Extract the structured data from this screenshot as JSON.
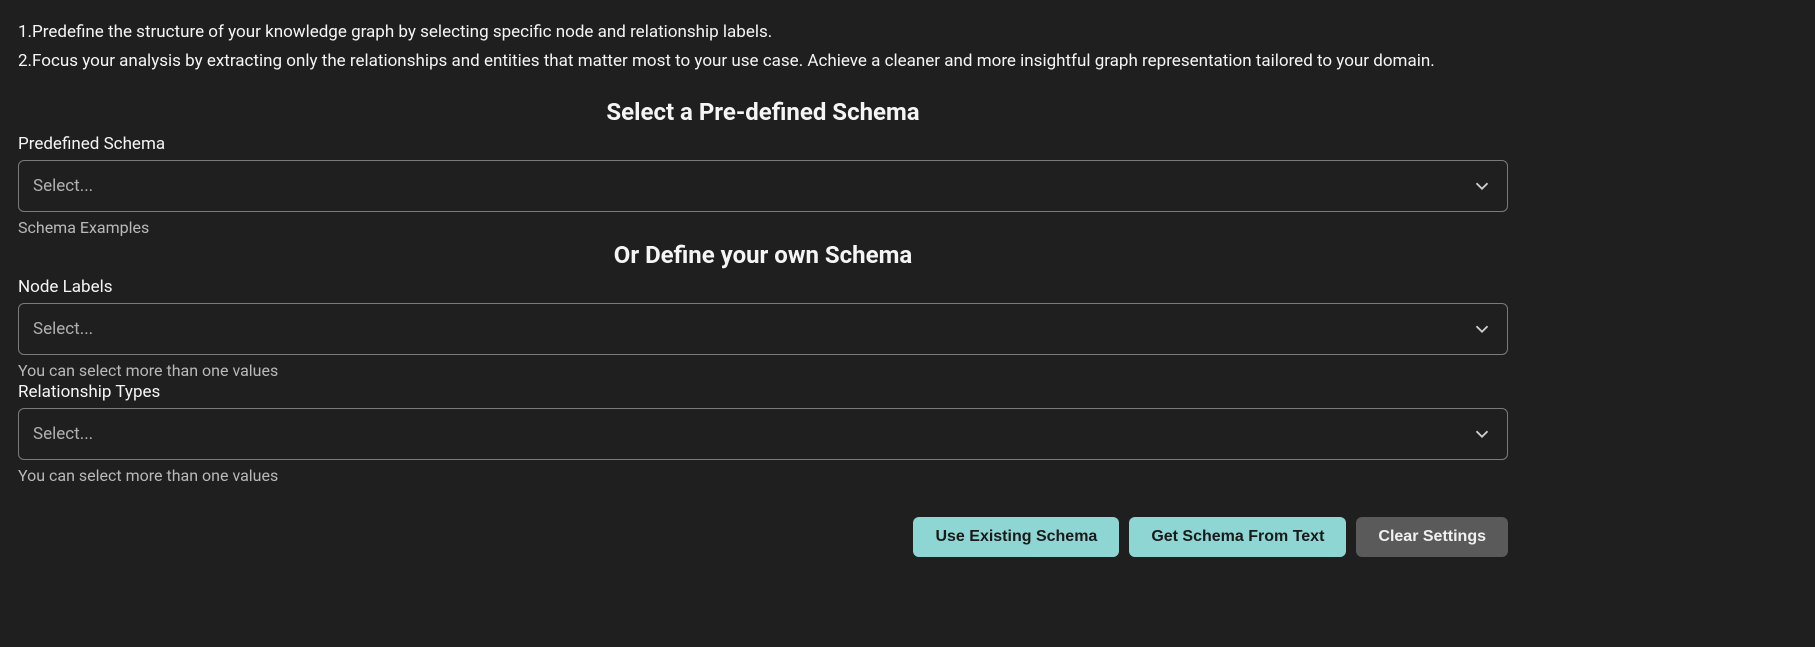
{
  "instructions": {
    "line1": "1.Predefine the structure of your knowledge graph by selecting specific node and relationship labels.",
    "line2": "2.Focus your analysis by extracting only the relationships and entities that matter most to your use case. Achieve a cleaner and more insightful graph representation tailored to your domain."
  },
  "sections": {
    "predefined": {
      "heading": "Select a Pre-defined Schema",
      "label": "Predefined Schema",
      "placeholder": "Select...",
      "helper": "Schema Examples"
    },
    "own": {
      "heading": "Or Define your own Schema",
      "nodeLabels": {
        "label": "Node Labels",
        "placeholder": "Select...",
        "helper": "You can select more than one values"
      },
      "relationshipTypes": {
        "label": "Relationship Types",
        "placeholder": "Select...",
        "helper": "You can select more than one values"
      }
    }
  },
  "buttons": {
    "useExisting": "Use Existing Schema",
    "getFromText": "Get Schema From Text",
    "clear": "Clear Settings"
  }
}
